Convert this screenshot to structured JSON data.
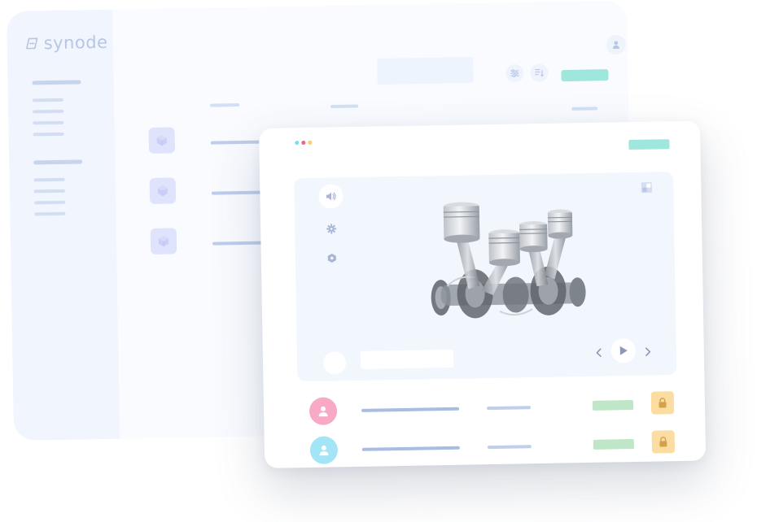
{
  "brand": {
    "name": "synode"
  },
  "colors": {
    "accent_teal": "#9fe6dc",
    "sidebar_bg": "#f1f5fd",
    "cube_bg": "#dfe3fb",
    "avatar_pink": "#f7a9c6",
    "avatar_cyan": "#a4e4f7",
    "status_green": "#bfe6c6",
    "lock_yellow": "#fbdca1",
    "dot_cyan": "#7fdcea",
    "dot_red": "#f0648a",
    "dot_yellow": "#f6cf6e"
  },
  "back_window": {
    "toolbar_icons": [
      "sliders-icon",
      "sort-list-icon"
    ],
    "header_icon": "user-icon",
    "row_icons": [
      "cube-icon",
      "cube-icon",
      "cube-icon"
    ]
  },
  "front_window": {
    "window_dots": [
      "dot-cyan",
      "dot-red",
      "dot-yellow"
    ],
    "viewer": {
      "model": "engine-crankshaft-pistons",
      "left_icons": [
        "speaker-icon",
        "gear-icon",
        "settings-icon"
      ],
      "corner_icon": "expand-icon",
      "controls": [
        "chevron-left-icon",
        "play-icon",
        "chevron-right-icon"
      ]
    },
    "users": [
      {
        "avatar_color": "#f7a9c6",
        "icon": "user-icon",
        "action_icon": "lock-icon"
      },
      {
        "avatar_color": "#a4e4f7",
        "icon": "user-icon",
        "action_icon": "lock-icon"
      }
    ]
  }
}
